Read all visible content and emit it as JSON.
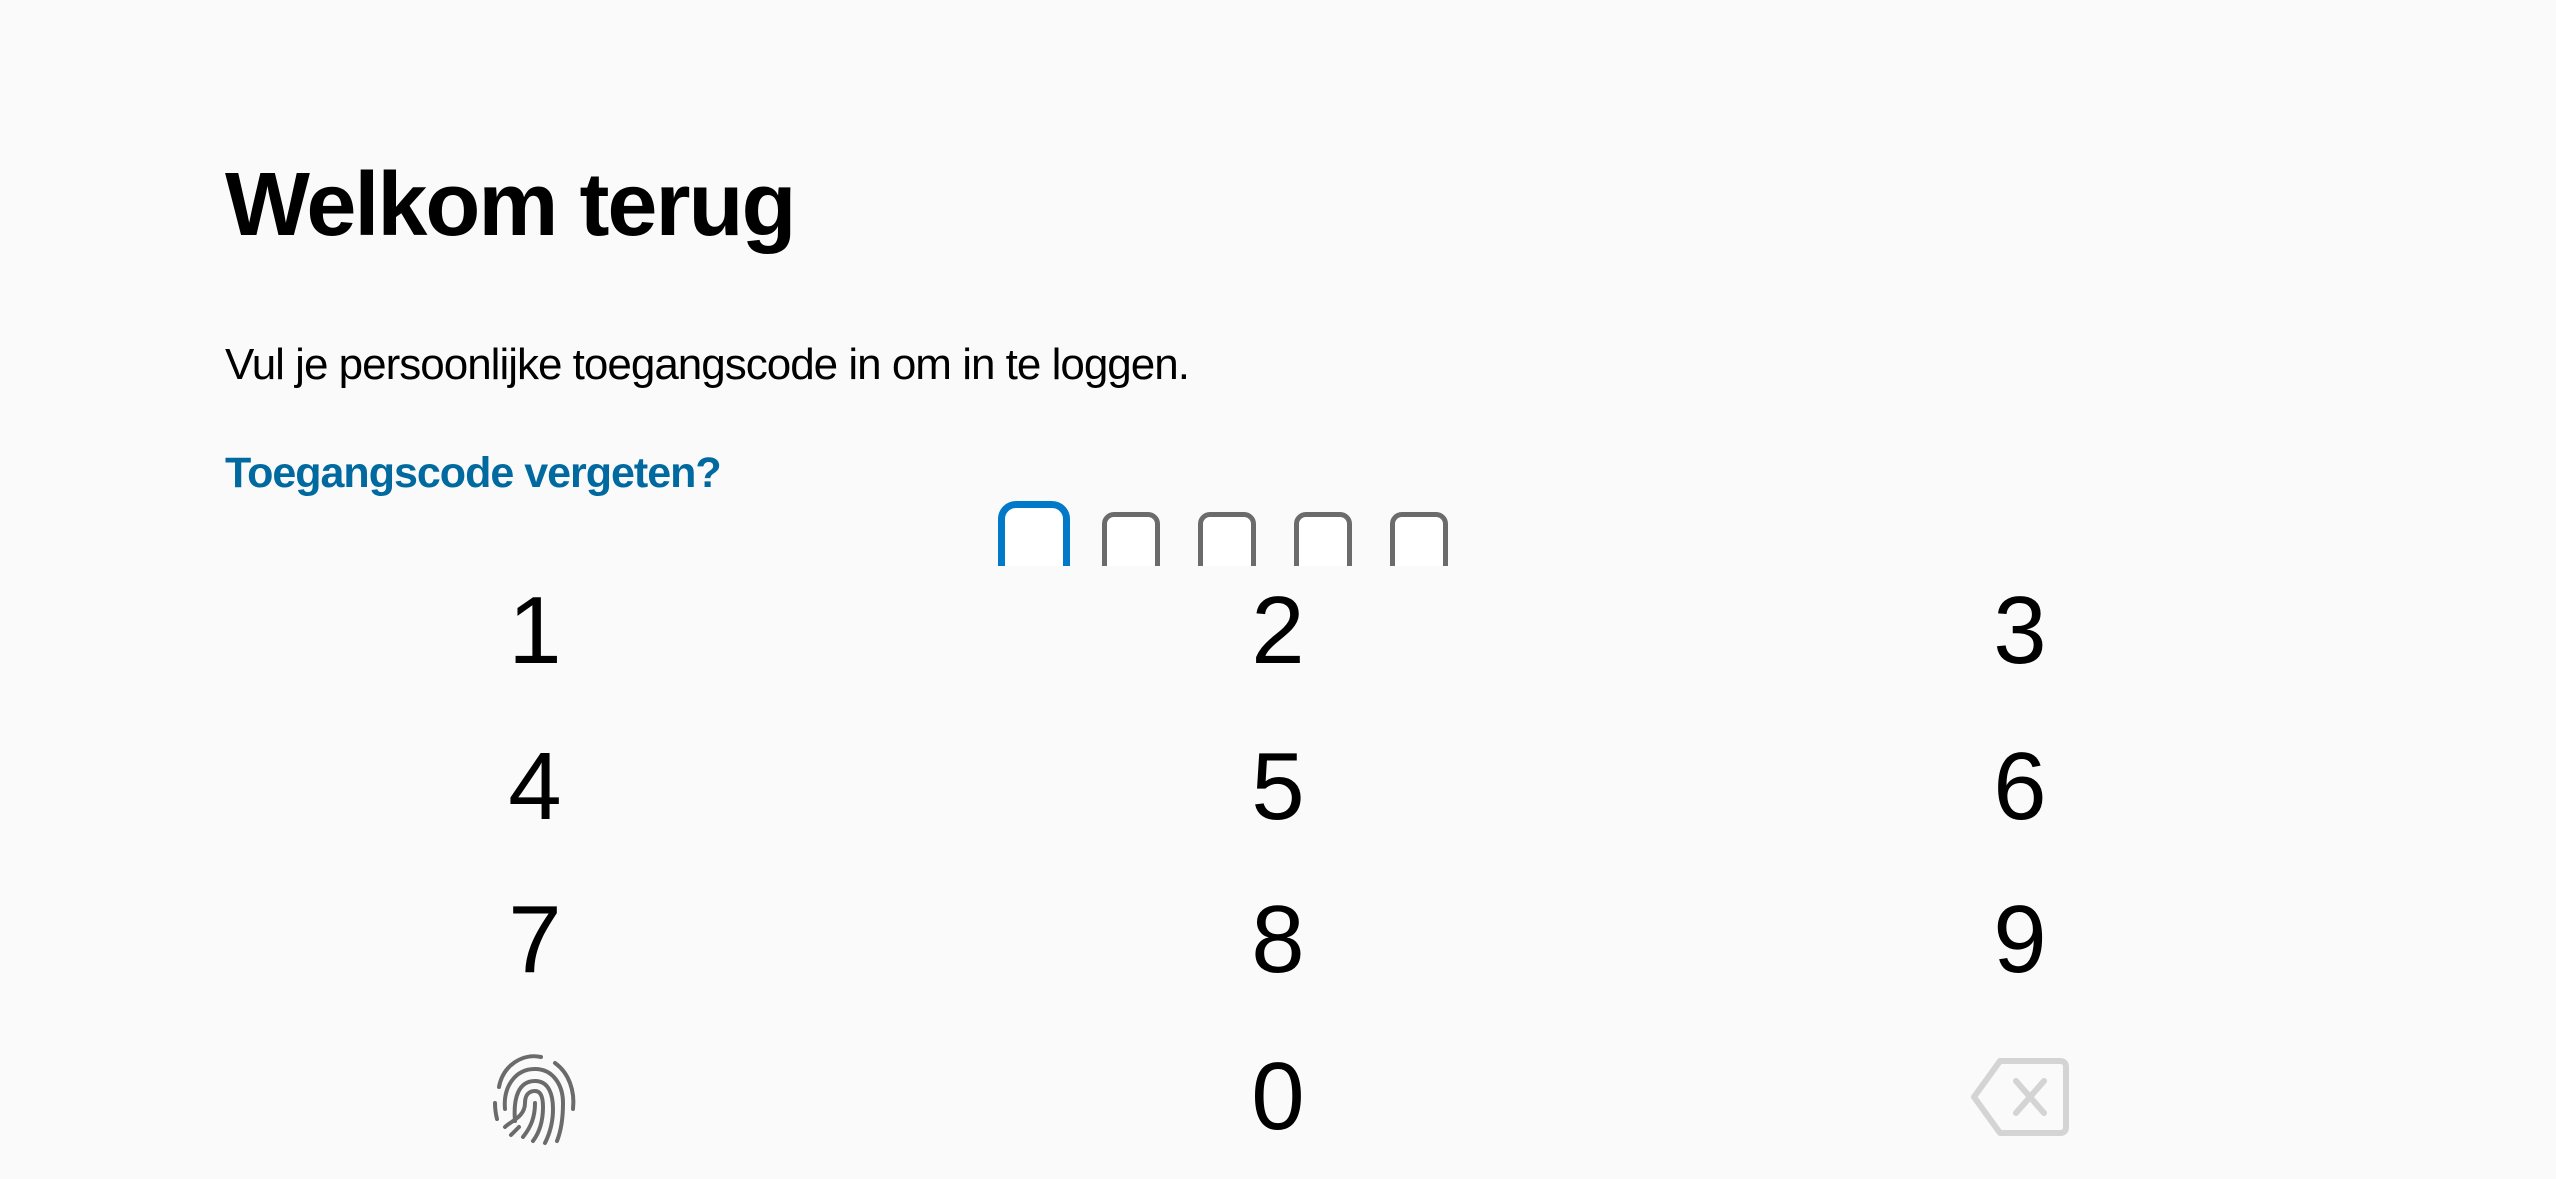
{
  "header": {
    "title": "Welkom terug",
    "subtitle": "Vul je persoonlijke toegangscode in om in te loggen.",
    "forgot_link": "Toegangscode vergeten?"
  },
  "pin": {
    "length": 5,
    "filled": 0,
    "active_index": 0,
    "active_color": "#0079c8",
    "inactive_color": "#6b6b6b"
  },
  "keypad": {
    "keys": [
      "1",
      "2",
      "3",
      "4",
      "5",
      "6",
      "7",
      "8",
      "9",
      "0"
    ],
    "biometric_icon": "fingerprint-icon",
    "delete_icon": "backspace-icon"
  },
  "colors": {
    "link": "#006aa0",
    "background": "#fafafa"
  }
}
